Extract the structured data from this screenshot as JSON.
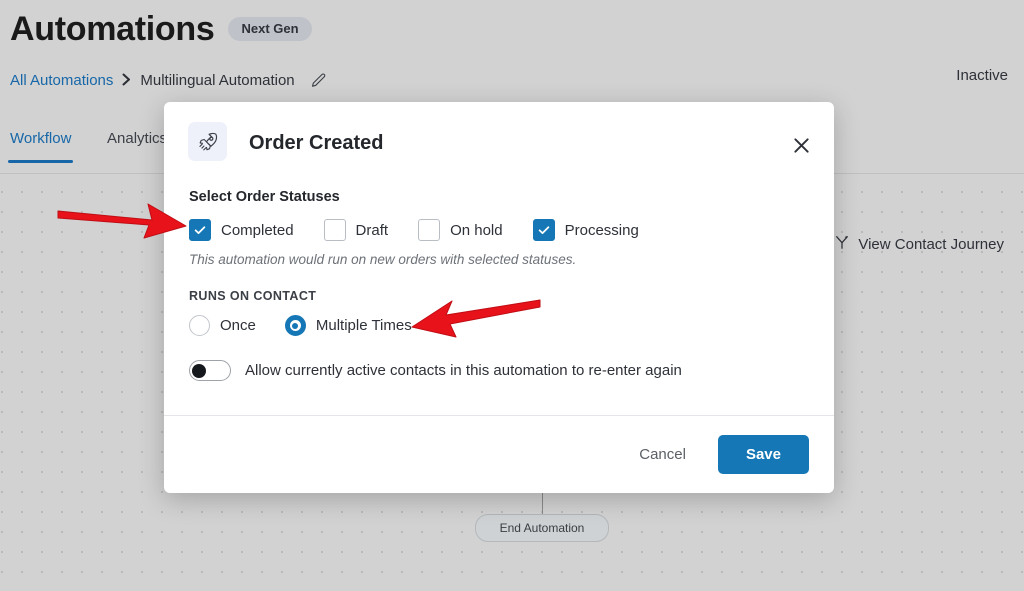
{
  "header": {
    "title": "Automations",
    "badge": "Next Gen",
    "status": "Inactive",
    "breadcrumb": {
      "root": "All Automations",
      "separator": "›",
      "current": "Multilingual Automation",
      "edit_icon": "pencil-icon"
    }
  },
  "tabs": [
    {
      "label": "Workflow",
      "active": true
    },
    {
      "label": "Analytics",
      "active": false
    }
  ],
  "canvas": {
    "view_contact_journey": "View Contact Journey",
    "journey_icon": "branch-icon",
    "end_node": "End Automation"
  },
  "modal": {
    "icon": "rocket-icon",
    "title": "Order Created",
    "close_icon": "close-icon",
    "statuses_label": "Select Order Statuses",
    "statuses": [
      {
        "label": "Completed",
        "checked": true
      },
      {
        "label": "Draft",
        "checked": false
      },
      {
        "label": "On hold",
        "checked": false
      },
      {
        "label": "Processing",
        "checked": true
      }
    ],
    "hint": "This automation would run on new orders with selected statuses.",
    "runs_on_contact_label": "RUNS ON CONTACT",
    "run_options": [
      {
        "label": "Once",
        "selected": false
      },
      {
        "label": "Multiple Times",
        "selected": true
      }
    ],
    "reenter_toggle": {
      "label": "Allow currently active contacts in this automation to re-enter again",
      "on": false
    },
    "cancel_label": "Cancel",
    "save_label": "Save"
  },
  "annotations": [
    {
      "name": "arrow-pointing-to-statuses",
      "color": "#e8121a",
      "direction": "right"
    },
    {
      "name": "arrow-pointing-to-multiple-times",
      "color": "#e8121a",
      "direction": "left"
    }
  ],
  "colors": {
    "accent": "#1577b5",
    "link": "#1767a8",
    "canvas": "#d2d2d2",
    "annotation": "#e8121a"
  }
}
